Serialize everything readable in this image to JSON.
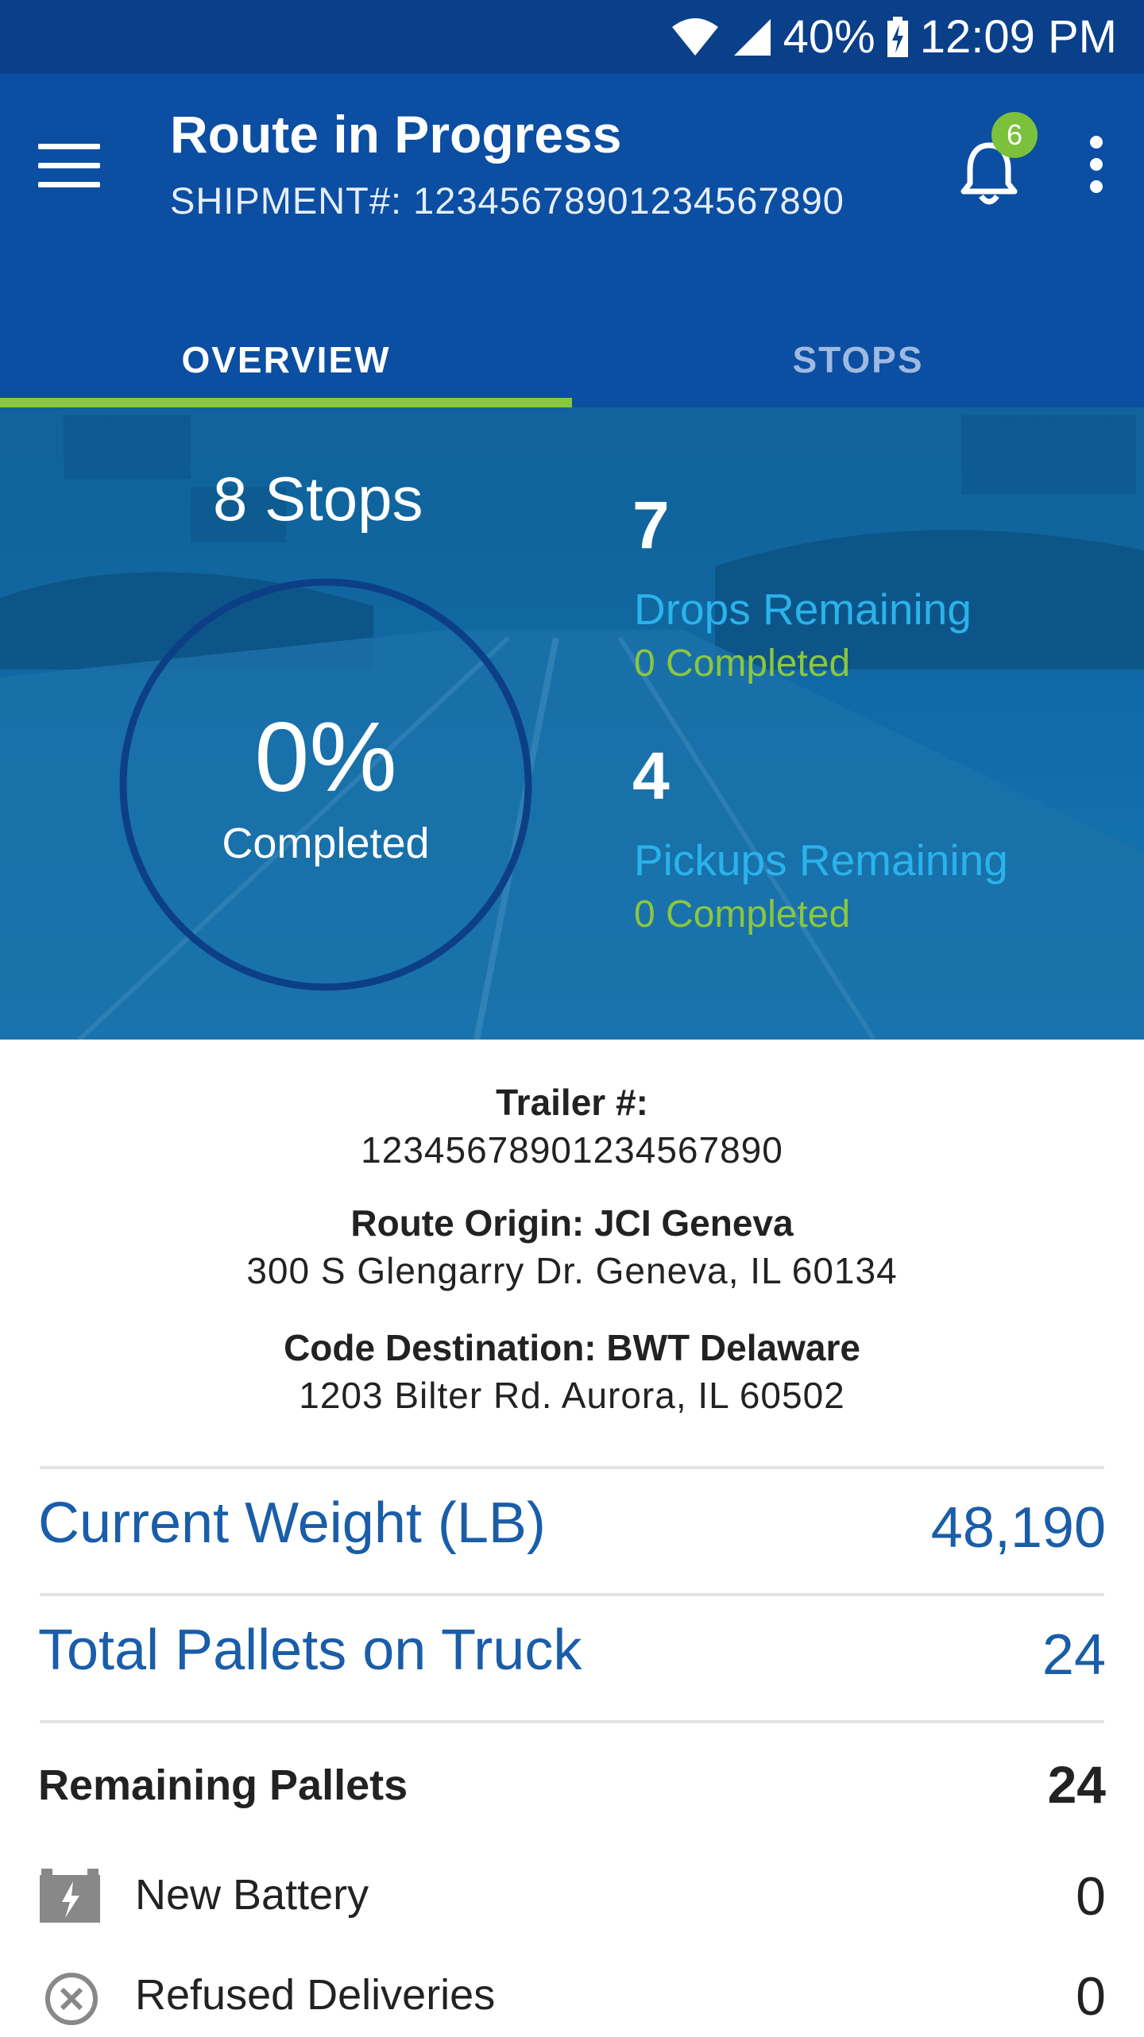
{
  "status_bar": {
    "battery": "40%",
    "time": "12:09 PM",
    "icons": [
      "wifi-icon",
      "signal-icon",
      "battery-charging-icon"
    ]
  },
  "header": {
    "title": "Route in Progress",
    "subtitle": "SHIPMENT#: 12345678901234567890",
    "notification_count": "6",
    "colors": {
      "primary": "#0b4ea2",
      "status": "#0a3f8a",
      "accent": "#8cc63f"
    }
  },
  "tabs": [
    {
      "label": "OVERVIEW",
      "active": true
    },
    {
      "label": "STOPS",
      "active": false
    }
  ],
  "overview": {
    "stops_label": "8 Stops",
    "percent": "0%",
    "percent_label": "Completed",
    "percent_value": 0,
    "drops": {
      "count": "7",
      "label": "Drops Remaining",
      "completed": "0 Completed"
    },
    "pickups": {
      "count": "4",
      "label": "Pickups Remaining",
      "completed": "0 Completed"
    }
  },
  "details": {
    "trailer_title": "Trailer #:",
    "trailer_value": "12345678901234567890",
    "origin_title": "Route Origin: JCI Geneva",
    "origin_address": "300 S Glengarry Dr. Geneva, IL 60134",
    "destination_title": "Code Destination: BWT Delaware",
    "destination_address": "1203 Bilter Rd.  Aurora, IL 60502"
  },
  "metrics": {
    "weight_label": "Current Weight (LB)",
    "weight_value": "48,190",
    "pallets_label": "Total Pallets on Truck",
    "pallets_value": "24"
  },
  "remaining": {
    "label": "Remaining Pallets",
    "value": "24",
    "items": [
      {
        "label": "New Battery",
        "value": "0",
        "icon": "battery-icon"
      },
      {
        "label": "Refused Deliveries",
        "value": "0",
        "icon": "refused-icon"
      }
    ]
  }
}
